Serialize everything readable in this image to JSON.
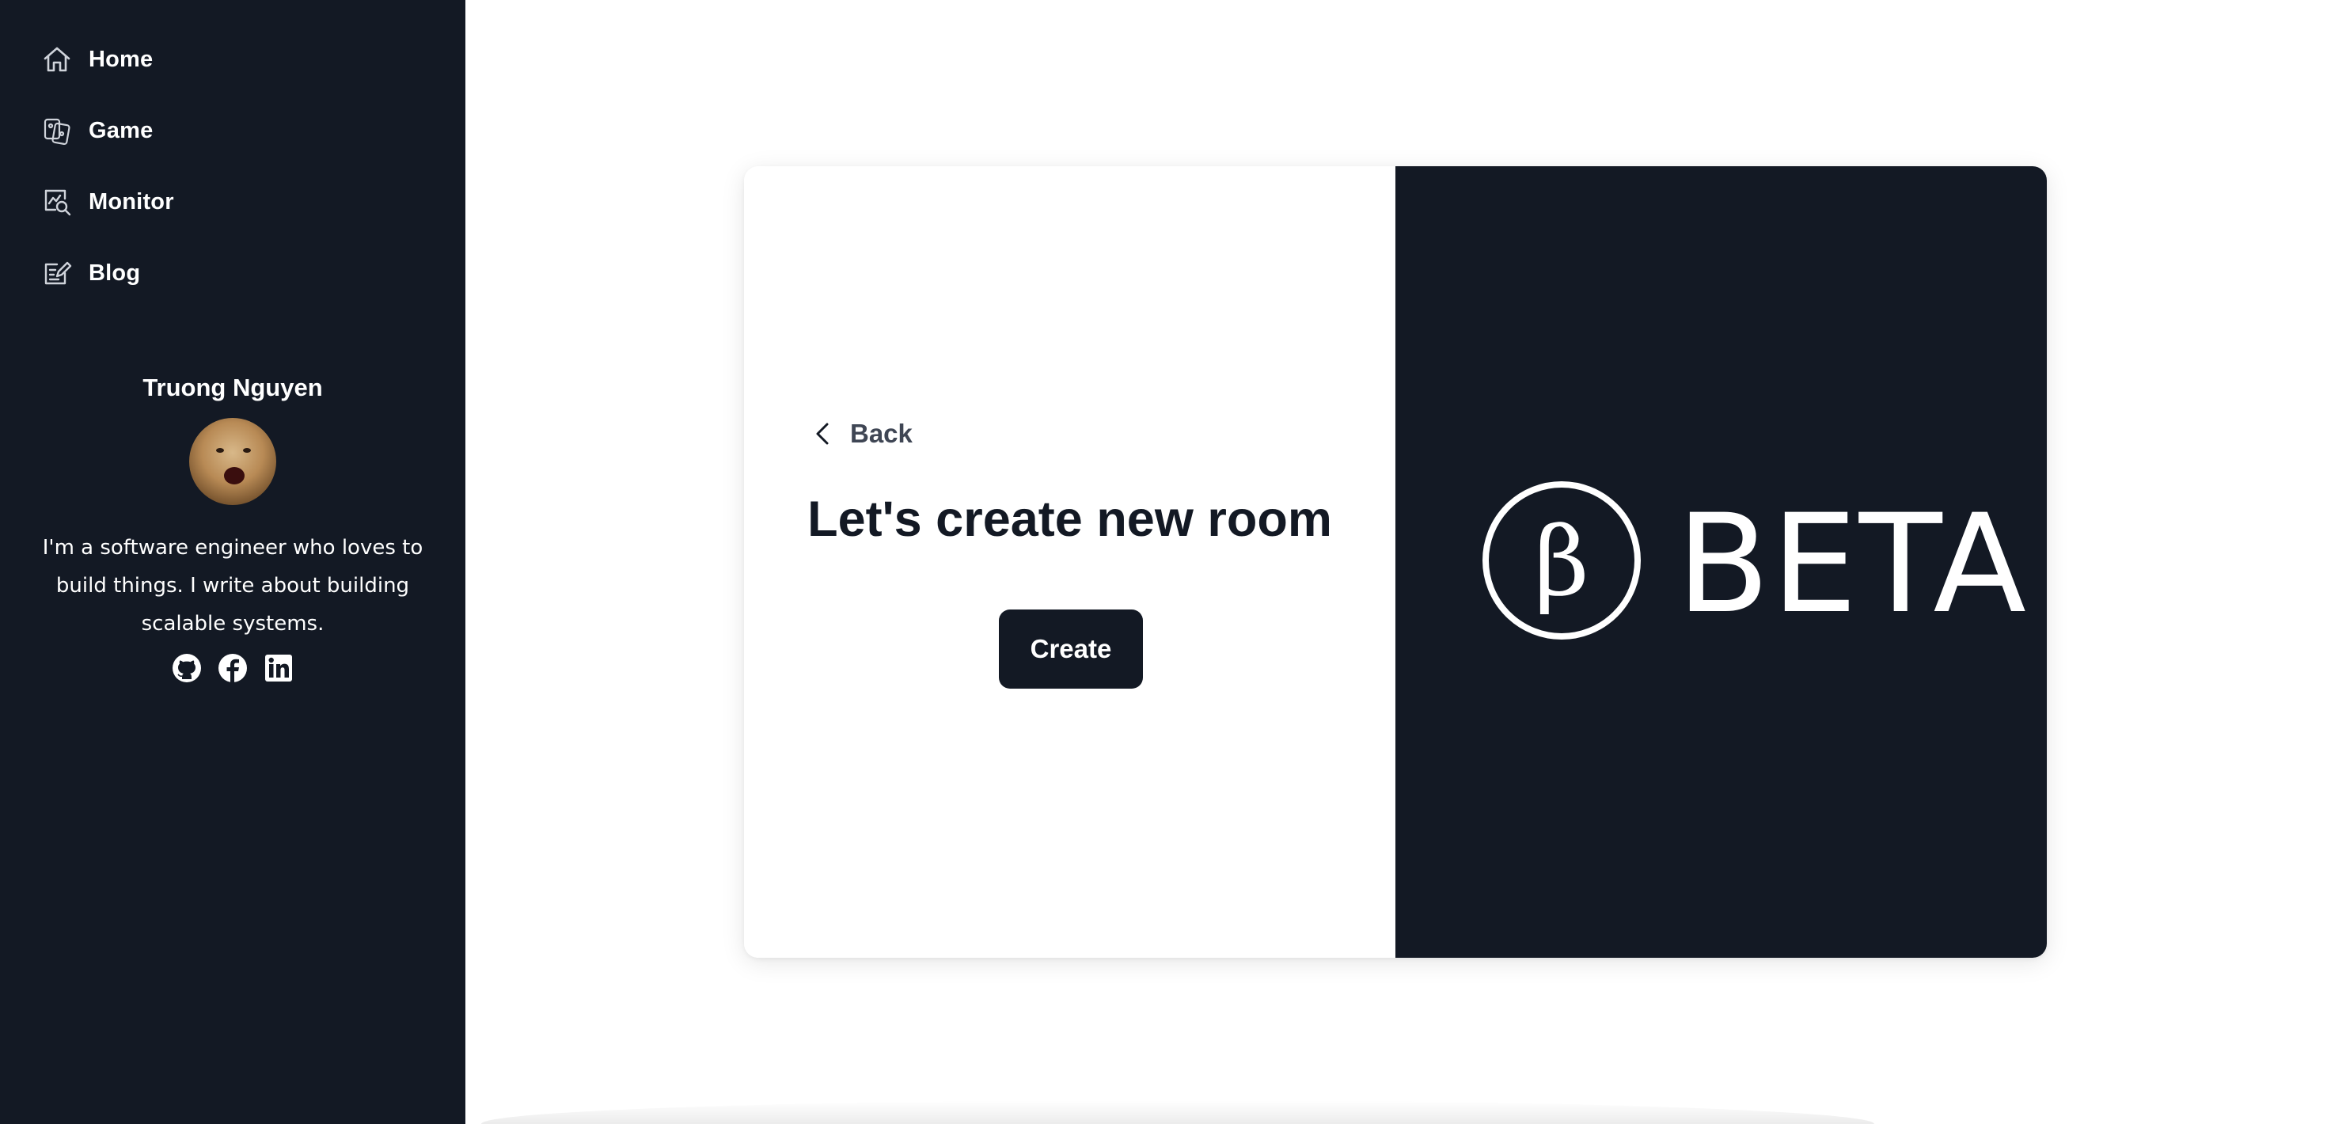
{
  "sidebar": {
    "nav": [
      {
        "label": "Home",
        "icon": "home-icon"
      },
      {
        "label": "Game",
        "icon": "game-icon"
      },
      {
        "label": "Monitor",
        "icon": "monitor-icon"
      },
      {
        "label": "Blog",
        "icon": "blog-icon"
      }
    ],
    "profile": {
      "name": "Truong Nguyen",
      "bio": "I'm a software engineer who loves to build things. I write about building scalable systems.",
      "socials": [
        "github-icon",
        "facebook-icon",
        "linkedin-icon"
      ]
    }
  },
  "main": {
    "card": {
      "back_label": "Back",
      "heading": "Let's create new room",
      "create_label": "Create",
      "logo_symbol": "β",
      "logo_text": "BETA"
    }
  },
  "colors": {
    "sidebar_bg": "#131924",
    "card_right_bg": "#131924",
    "button_bg": "#131924",
    "text_dark": "#131924",
    "back_text": "#3f4654"
  }
}
